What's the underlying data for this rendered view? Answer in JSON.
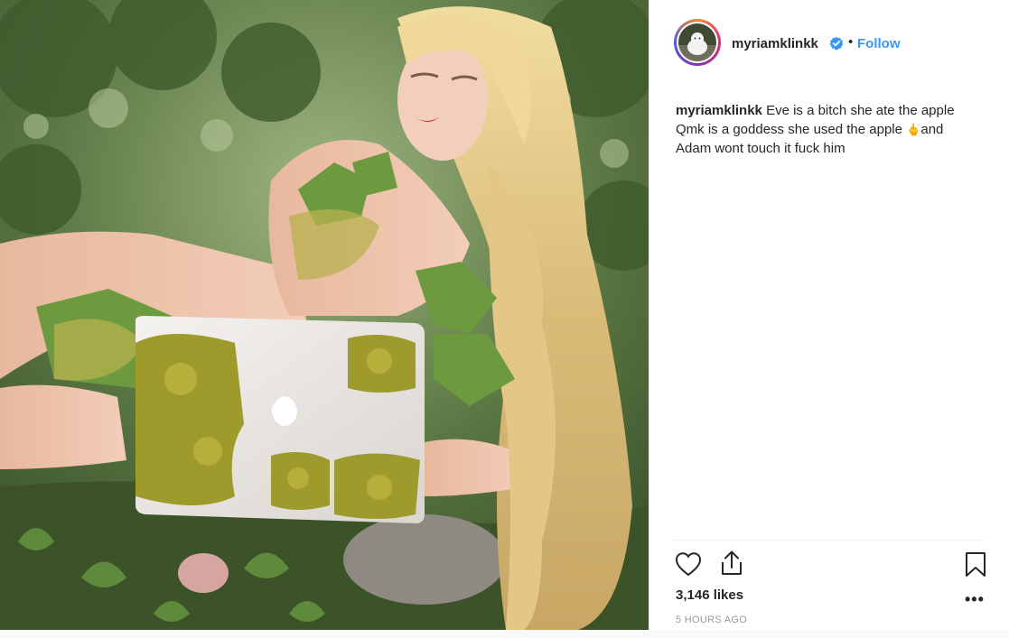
{
  "post": {
    "username": "myriamklinkk",
    "separator": "•",
    "follow_label": "Follow",
    "caption_username": "myriamklinkk",
    "caption_line1": "Eve is a bitch she ate the apple",
    "caption_line2": "Qmk is a goddess she used the apple",
    "caption_emoji": "🖕",
    "caption_line2b": "and",
    "caption_line3": "Adam wont touch it fuck him",
    "likes": "3,146 likes",
    "timestamp": "5 HOURS AGO",
    "more_label": "•••"
  },
  "colors": {
    "link": "#3897f0",
    "verified": "#3897f0",
    "text": "#262626",
    "muted": "#999999"
  },
  "icons": [
    "heart-icon",
    "share-icon",
    "bookmark-icon",
    "verified-badge-icon",
    "more-options-icon"
  ]
}
